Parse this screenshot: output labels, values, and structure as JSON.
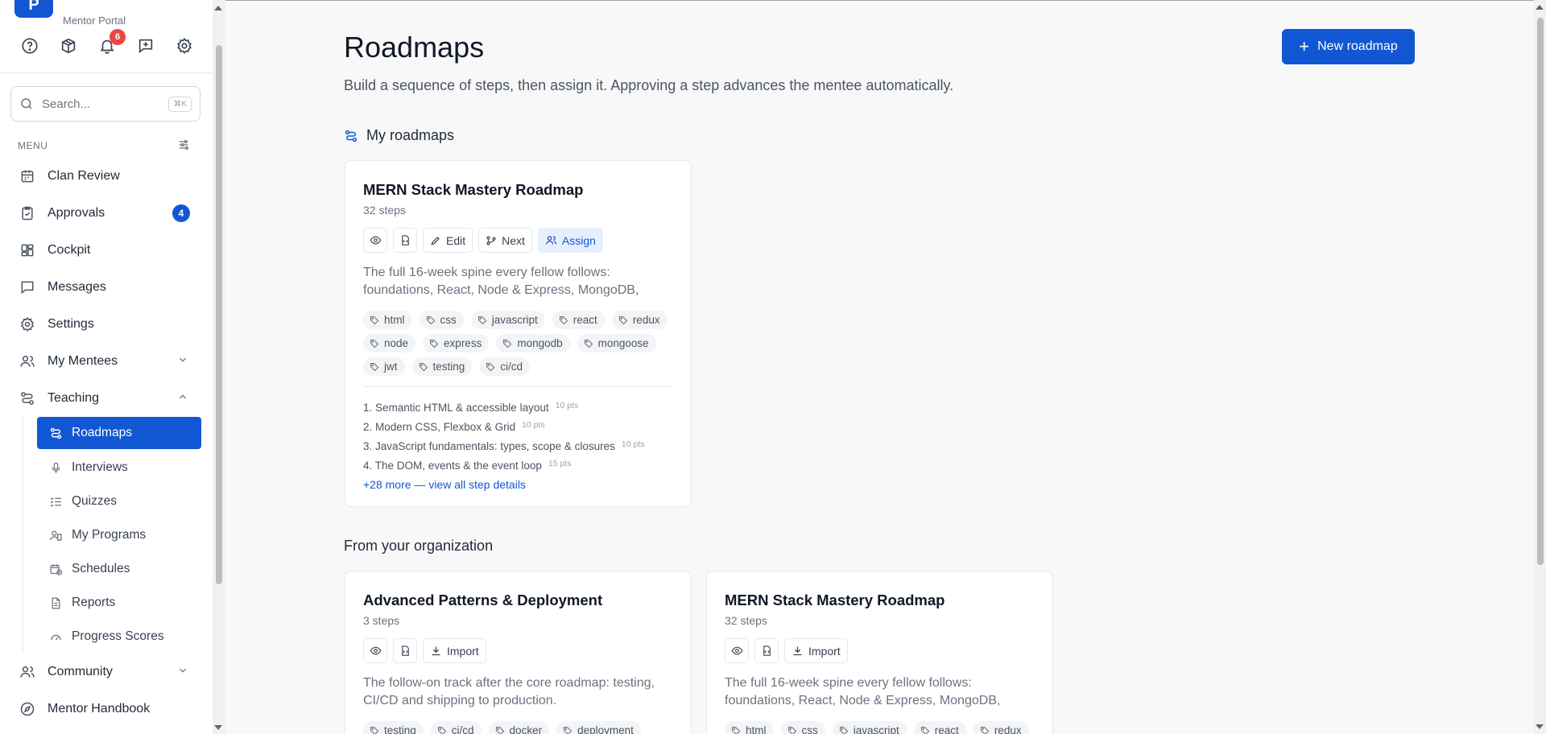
{
  "brand": {
    "logo_letter": "P",
    "subtitle": "Mentor Portal"
  },
  "topbar": {
    "icons": [
      "help-icon",
      "box-icon",
      "bell-icon",
      "message-plus-icon",
      "gear-icon"
    ],
    "notification_count": "6"
  },
  "search": {
    "placeholder": "Search...",
    "shortcut": "⌘K"
  },
  "menu": {
    "label": "MENU",
    "items": [
      {
        "label": "Clan Review",
        "icon": "calendar-icon"
      },
      {
        "label": "Approvals",
        "icon": "clipboard-check-icon",
        "badge": "4"
      },
      {
        "label": "Cockpit",
        "icon": "dashboard-icon"
      },
      {
        "label": "Messages",
        "icon": "chat-icon"
      },
      {
        "label": "Settings",
        "icon": "gear-icon"
      },
      {
        "label": "My Mentees",
        "icon": "users-icon"
      },
      {
        "label": "Teaching",
        "icon": "route-icon"
      }
    ],
    "teaching_sub": [
      {
        "label": "Roadmaps",
        "icon": "route-icon",
        "active": true
      },
      {
        "label": "Interviews",
        "icon": "mic-icon"
      },
      {
        "label": "Quizzes",
        "icon": "list-check-icon"
      },
      {
        "label": "My Programs",
        "icon": "building-icon"
      },
      {
        "label": "Schedules",
        "icon": "calendar-clock-icon"
      },
      {
        "label": "Reports",
        "icon": "file-icon"
      },
      {
        "label": "Progress Scores",
        "icon": "gauge-icon"
      }
    ],
    "after": [
      {
        "label": "Community",
        "icon": "users-icon"
      },
      {
        "label": "Mentor Handbook",
        "icon": "compass-icon"
      }
    ]
  },
  "page": {
    "title": "Roadmaps",
    "subtitle": "Build a sequence of steps, then assign it. Approving a step advances the mentee automatically.",
    "new_button": "New roadmap",
    "my_section": "My roadmaps",
    "org_section": "From your organization"
  },
  "my_roadmaps": [
    {
      "title": "MERN Stack Mastery Roadmap",
      "steps": "32 steps",
      "actions": {
        "edit": "Edit",
        "next": "Next",
        "assign": "Assign"
      },
      "description": "The full 16-week spine every fellow follows: foundations, React, Node & Express, MongoDB, full-…",
      "tags": [
        "html",
        "css",
        "javascript",
        "react",
        "redux",
        "node",
        "express",
        "mongodb",
        "mongoose",
        "jwt",
        "testing",
        "ci/cd"
      ],
      "step_list": [
        {
          "name": "1. Semantic HTML & accessible layout",
          "pts": "10 pts"
        },
        {
          "name": "2. Modern CSS, Flexbox & Grid",
          "pts": "10 pts"
        },
        {
          "name": "3. JavaScript fundamentals: types, scope & closures",
          "pts": "10 pts"
        },
        {
          "name": "4. The DOM, events & the event loop",
          "pts": "15 pts"
        }
      ],
      "more": "+28 more — view all step details"
    }
  ],
  "org_roadmaps": [
    {
      "title": "Advanced Patterns & Deployment",
      "steps": "3 steps",
      "import": "Import",
      "description": "The follow-on track after the core roadmap: testing, CI/CD and shipping to production.",
      "tags": [
        "testing",
        "ci/cd",
        "docker",
        "deployment"
      ]
    },
    {
      "title": "MERN Stack Mastery Roadmap",
      "steps": "32 steps",
      "import": "Import",
      "description": "The full 16-week spine every fellow follows: foundations, React, Node & Express, MongoDB, full-…",
      "tags": [
        "html",
        "css",
        "javascript",
        "react",
        "redux"
      ]
    }
  ]
}
